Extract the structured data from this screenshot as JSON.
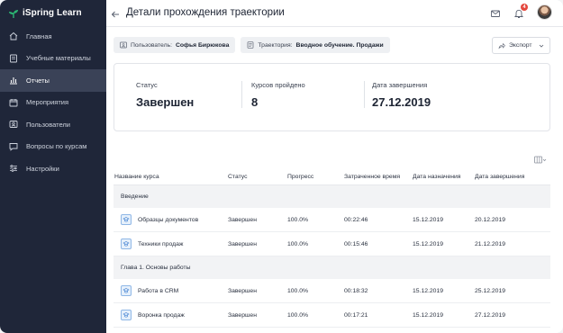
{
  "brand": {
    "name": "iSpring Learn",
    "accent": "#2bb673"
  },
  "sidebar": {
    "items": [
      {
        "label": "Главная",
        "icon": "home-icon",
        "active": false
      },
      {
        "label": "Учебные материалы",
        "icon": "book-icon",
        "active": false
      },
      {
        "label": "Отчеты",
        "icon": "chart-icon",
        "active": true
      },
      {
        "label": "Мероприятия",
        "icon": "calendar-icon",
        "active": false
      },
      {
        "label": "Пользователи",
        "icon": "users-icon",
        "active": false
      },
      {
        "label": "Вопросы по курсам",
        "icon": "chat-icon",
        "active": false
      },
      {
        "label": "Настройки",
        "icon": "sliders-icon",
        "active": false
      }
    ]
  },
  "header": {
    "title": "Детали прохождения траектории",
    "notifications_count": "4"
  },
  "filters": {
    "user_label": "Пользователь:",
    "user_value": "Софья Бирюкова",
    "trajectory_label": "Траектория:",
    "trajectory_value": "Вводное обучение. Продажи",
    "export_label": "Экспорт"
  },
  "stats": {
    "status_label": "Статус",
    "status_value": "Завершен",
    "courses_label": "Курсов пройдено",
    "courses_value": "8",
    "date_label": "Дата завершения",
    "date_value": "27.12.2019"
  },
  "table": {
    "columns": [
      "Название курса",
      "Статус",
      "Прогресс",
      "Затраченное время",
      "Дата назначения",
      "Дата завершения"
    ],
    "groups": [
      {
        "title": "Введение",
        "rows": [
          {
            "name": "Образцы документов",
            "status": "Завершен",
            "progress": "100.0%",
            "time": "00:22:46",
            "assigned": "15.12.2019",
            "completed": "20.12.2019"
          },
          {
            "name": "Техники продаж",
            "status": "Завершен",
            "progress": "100.0%",
            "time": "00:15:46",
            "assigned": "15.12.2019",
            "completed": "21.12.2019"
          }
        ]
      },
      {
        "title": "Глава 1. Основы работы",
        "rows": [
          {
            "name": "Работа в CRM",
            "status": "Завершен",
            "progress": "100.0%",
            "time": "00:18:32",
            "assigned": "15.12.2019",
            "completed": "25.12.2019"
          },
          {
            "name": "Воронка продаж",
            "status": "Завершен",
            "progress": "100.0%",
            "time": "00:17:21",
            "assigned": "15.12.2019",
            "completed": "27.12.2019"
          }
        ]
      }
    ]
  }
}
